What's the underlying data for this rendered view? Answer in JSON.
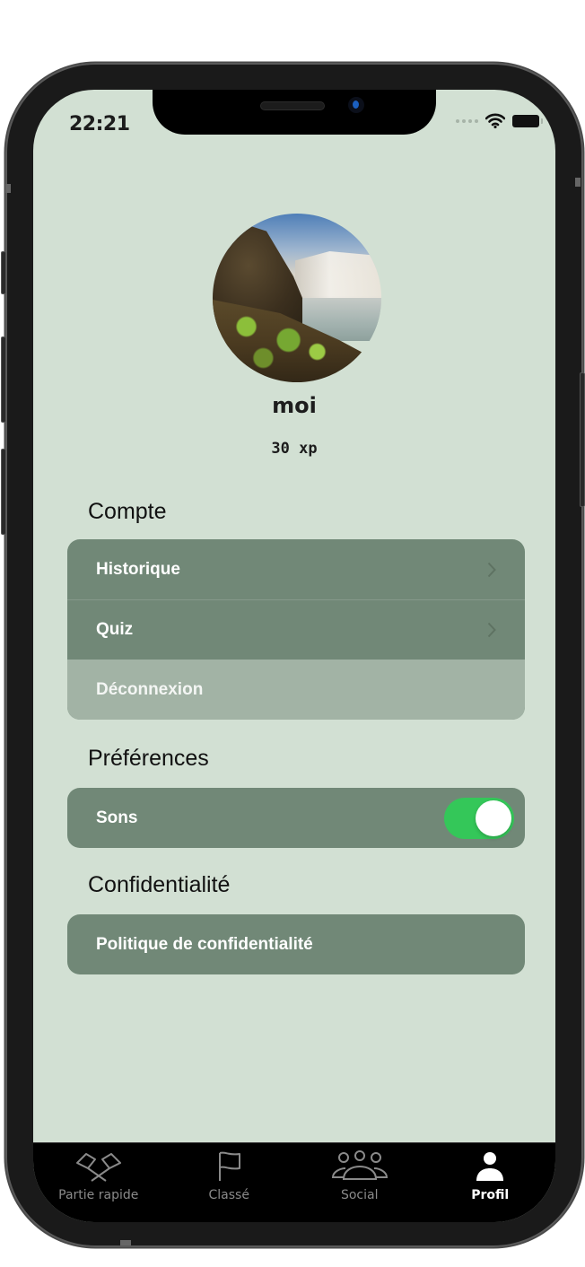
{
  "status_bar": {
    "time": "22:21",
    "icons": [
      "signal-dots-icon",
      "wifi-icon",
      "battery-icon"
    ]
  },
  "profile": {
    "avatar": "waterfall-landscape-photo",
    "username": "moi",
    "xp": "30 xp"
  },
  "sections": {
    "account": {
      "title": "Compte",
      "items": [
        {
          "label": "Historique",
          "icon": "chevron-right-icon"
        },
        {
          "label": "Quiz",
          "icon": "chevron-right-icon"
        },
        {
          "label": "Déconnexion"
        }
      ]
    },
    "preferences": {
      "title": "Préférences",
      "items": [
        {
          "label": "Sons",
          "toggle_on": true
        }
      ]
    },
    "privacy": {
      "title": "Confidentialité",
      "items": [
        {
          "label": "Politique de confidentialité"
        }
      ]
    }
  },
  "colors": {
    "background": "#d2e0d3",
    "row": "#718877",
    "row_disabled": "#a2b3a5",
    "toggle_on": "#34c759"
  },
  "tabbar": {
    "tabs": [
      {
        "label": "Partie rapide",
        "icon": "crossed-flags-icon",
        "active": false
      },
      {
        "label": "Classé",
        "icon": "flag-icon",
        "active": false
      },
      {
        "label": "Social",
        "icon": "people-group-icon",
        "active": false
      },
      {
        "label": "Profil",
        "icon": "person-icon",
        "active": true
      }
    ]
  }
}
